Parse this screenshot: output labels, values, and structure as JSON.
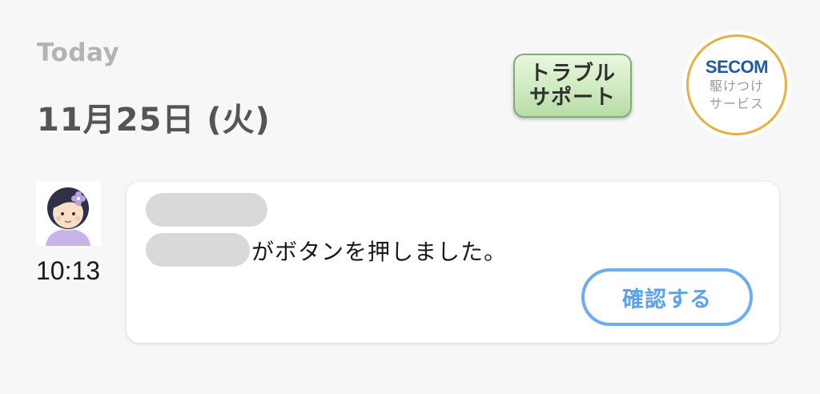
{
  "header": {
    "today_label": "Today",
    "date": "11月25日 (火)"
  },
  "trouble_support": {
    "line1": "トラブル",
    "line2": "サポート"
  },
  "secom": {
    "logo": "SECOM",
    "line1": "駆けつけ",
    "line2": "サービス",
    "logo_color": "#1f5aa6",
    "ring_color": "#e8b042"
  },
  "entry": {
    "avatar_icon": "child-avatar-icon",
    "time": "10:13",
    "message": "がボタンを押しました。",
    "confirm_label": "確認する",
    "accent_color": "#5aa2ea"
  }
}
